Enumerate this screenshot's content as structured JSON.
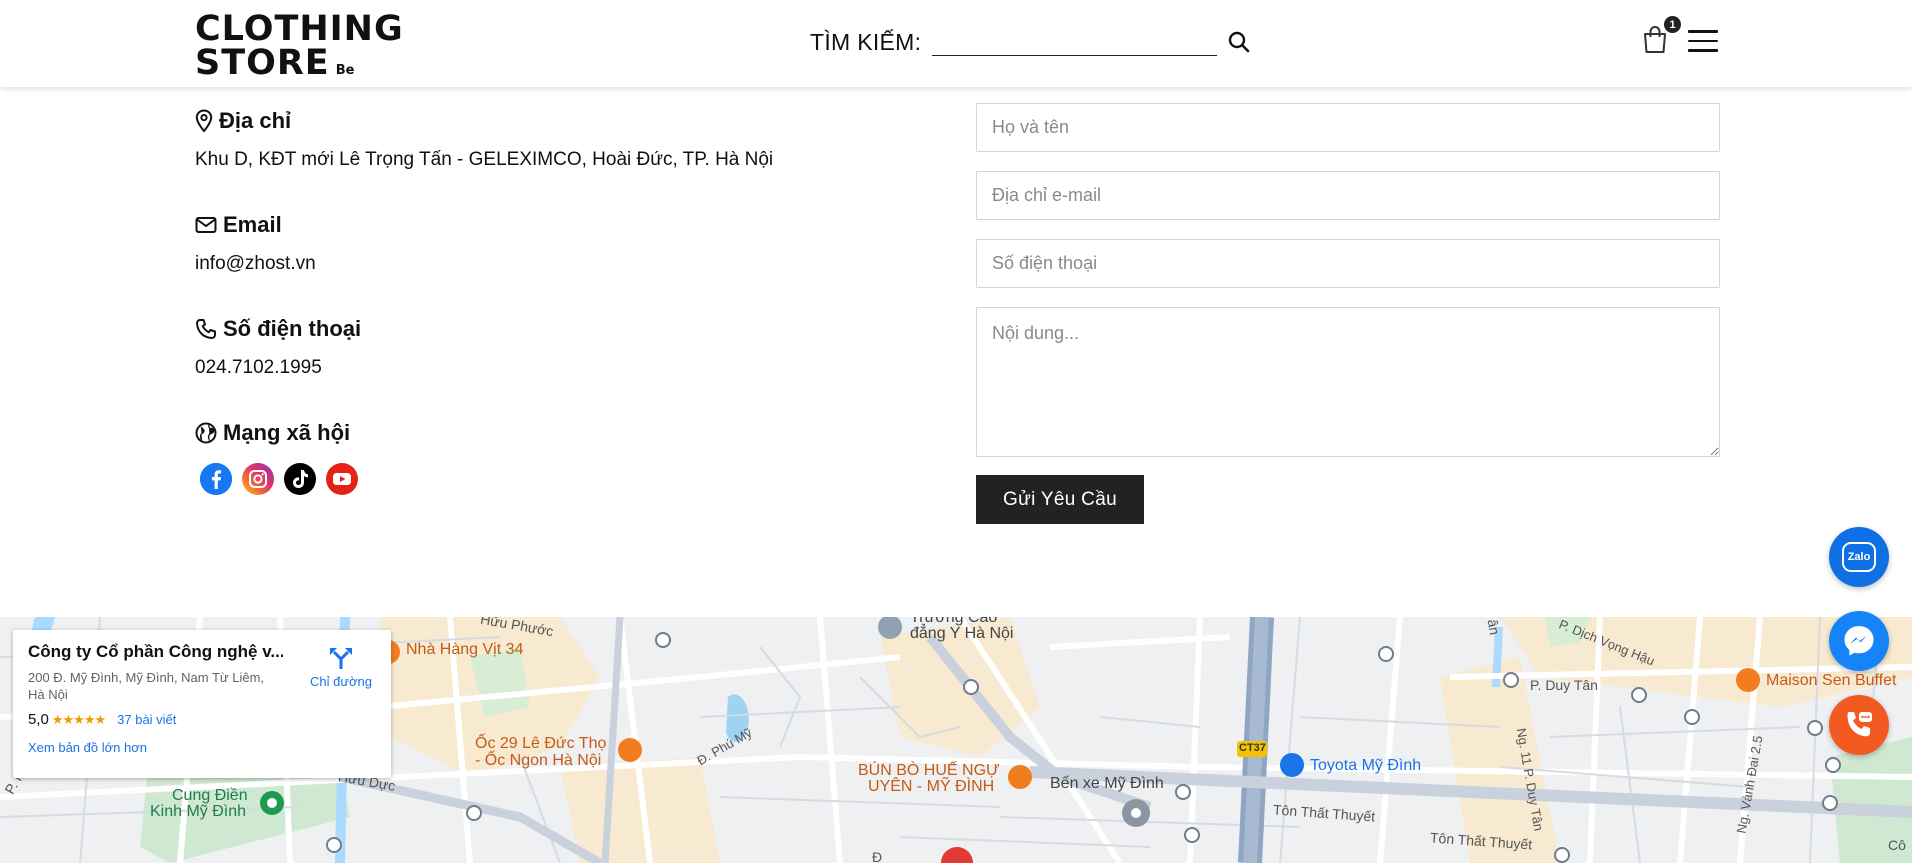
{
  "header": {
    "logo_line1": "CLOTHING",
    "logo_line2": "STORE",
    "logo_suffix": "Be",
    "search_label": "TÌM KIẾM:",
    "search_value": "",
    "search_icon": "search-icon",
    "cart_count": "1",
    "cart_icon": "shopping-bag-icon",
    "menu_icon": "hamburger-menu-icon"
  },
  "contact": {
    "address_heading": "Địa chỉ",
    "address": "Khu D, KĐT mới Lê Trọng Tấn - GELEXIMCO, Hoài Đức, TP. Hà Nội",
    "email_heading": "Email",
    "email": "info@zhost.vn",
    "phone_heading": "Số điện thoại",
    "phone": "024.7102.1995",
    "social_heading": "Mạng xã hội",
    "socials": [
      "facebook-icon",
      "instagram-icon",
      "tiktok-icon",
      "youtube-icon"
    ]
  },
  "form": {
    "name_placeholder": "Họ và tên",
    "email_placeholder": "Địa chỉ e-mail",
    "phone_placeholder": "Số điện thoại",
    "message_placeholder": "Nội dung...",
    "submit_label": "Gửi Yêu Cầu"
  },
  "map": {
    "card": {
      "title": "Công ty Cổ phần Công nghệ v...",
      "address": "200 Đ. Mỹ Đình, Mỹ Đình, Nam Từ Liêm, Hà Nội",
      "rating": "5,0",
      "stars": "★★★★★",
      "reviews": "37 bài viết",
      "directions": "Chỉ đường",
      "larger_map": "Xem bản đồ lớn hơn"
    },
    "labels": {
      "nha_hang": "Nhà Hàng Vịt 34",
      "truong_cao_dang_1": "Trường Cao",
      "truong_cao_dang_2": "đẳng Y Hà Nội",
      "oc_1": "Ốc 29 Lê Đức Thọ",
      "oc_2": "- Ốc Ngon Hà Nội",
      "bun_bo_1": "BÚN BÒ HUẾ NGỰ",
      "bun_bo_2": "UYÊN - MỸ ĐÌNH",
      "ben_xe": "Bến xe Mỹ Đình",
      "toyota": "Toyota Mỹ Đình",
      "maison": "Maison Sen Buffet",
      "cung_dien_1": "Cung Điền",
      "cung_dien_2": "Kinh Mỹ Đình",
      "ton_that_thuyet_1": "Tôn Thất Thuyết",
      "ton_that_thuyet_2": "Tôn Thất Thuyết",
      "p_duy_tan": "P. Duy Tân",
      "ng_duy_tan": "Ng. 11 P. Duy Tân",
      "d_phu_my": "Đ. Phú Mỹ",
      "huu_phuoc": "Hữu Phước",
      "huu_duc": "Hữu Dực",
      "dich_vong_hau": "P. Dịch Vọng Hậu",
      "vanh_dai": "Ng. Vành Đai 2.5",
      "ct37": "CT37",
      "p_nguy": "P. Ngu",
      "con": "Cô",
      "d_label": "Đ",
      "an_label": "ân"
    }
  },
  "floating": {
    "zalo_label": "Zalo",
    "messenger_icon": "messenger-icon",
    "call_icon": "phone-call-icon"
  }
}
